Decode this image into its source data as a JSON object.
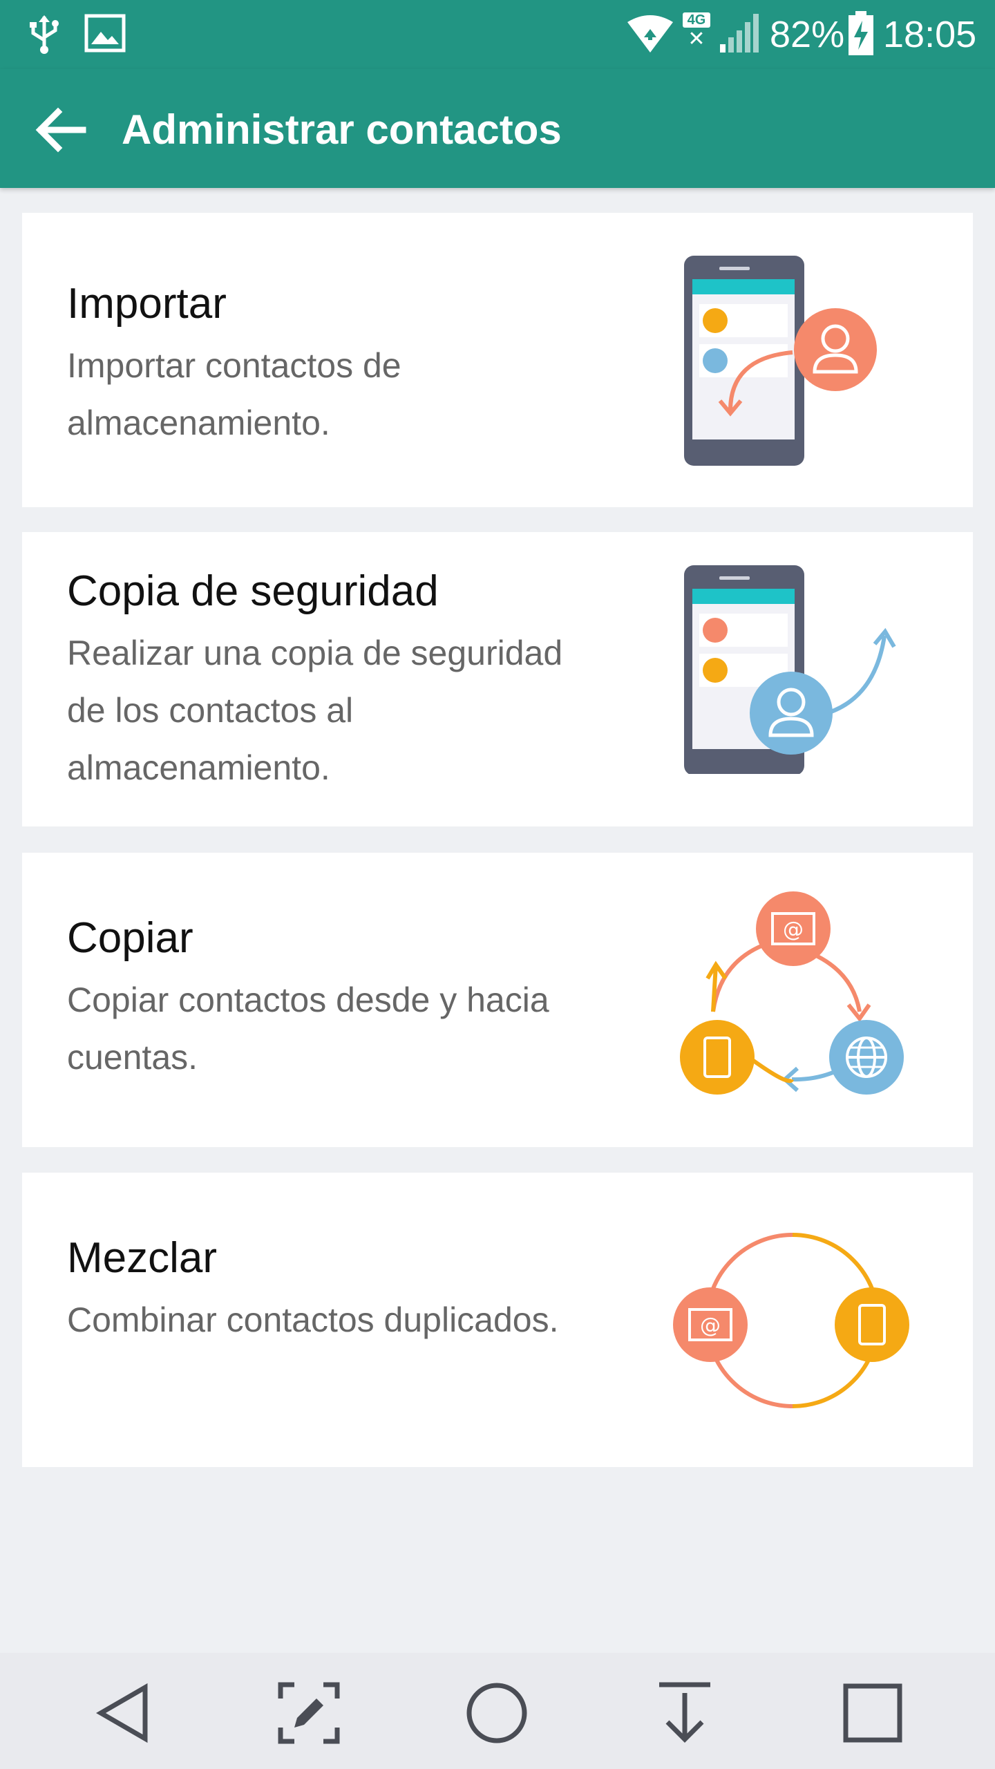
{
  "status_bar": {
    "battery_percent": "82%",
    "time": "18:05",
    "network_label": "4G",
    "icons": [
      "usb-icon",
      "image-icon",
      "wifi-icon",
      "mobile-data-icon",
      "signal-icon",
      "battery-charging-icon"
    ]
  },
  "app_bar": {
    "title": "Administrar contactos",
    "back_icon": "arrow-back-icon"
  },
  "cards": [
    {
      "title": "Importar",
      "description": "Importar contactos de almacenamiento.",
      "illustration": "import-contacts-illustration"
    },
    {
      "title": "Copia de seguridad",
      "description": "Realizar una copia de seguridad de los contactos al almacenamiento.",
      "illustration": "backup-contacts-illustration"
    },
    {
      "title": "Copiar",
      "description": "Copiar contactos desde y hacia cuentas.",
      "illustration": "copy-contacts-illustration"
    },
    {
      "title": "Mezclar",
      "description": "Combinar contactos duplicados.",
      "illustration": "merge-contacts-illustration"
    }
  ],
  "nav_bar": {
    "icons": [
      "back-icon",
      "capture-edit-icon",
      "home-icon",
      "notification-pull-icon",
      "recents-icon"
    ]
  },
  "colors": {
    "primary": "#229583",
    "background": "#eef0f3",
    "orange": "#f5896b",
    "yellow": "#f5a914",
    "blue": "#7ab8de",
    "phone_body": "#585e72"
  }
}
